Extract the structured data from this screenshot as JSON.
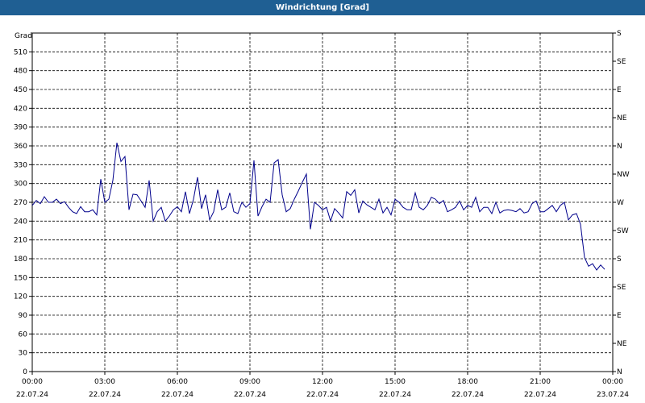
{
  "window": {
    "title": "Windrichtung [Grad]"
  },
  "chart_data": {
    "type": "line",
    "title": "Windrichtung [Grad]",
    "ylabel": "Grad",
    "ylim": [
      0,
      540
    ],
    "yticks": [
      0,
      30,
      60,
      90,
      120,
      150,
      180,
      210,
      240,
      270,
      300,
      330,
      360,
      390,
      420,
      450,
      480,
      510
    ],
    "right_axis_labels": [
      "N",
      "NE",
      "E",
      "SE",
      "S",
      "SW",
      "W",
      "NW",
      "N",
      "NE",
      "E",
      "SE",
      "S"
    ],
    "xlim": [
      "22.07.24 00:00",
      "23.07.24 00:00"
    ],
    "xticks": [
      {
        "time": "00:00",
        "date": "22.07.24"
      },
      {
        "time": "03:00",
        "date": "22.07.24"
      },
      {
        "time": "06:00",
        "date": "22.07.24"
      },
      {
        "time": "09:00",
        "date": "22.07.24"
      },
      {
        "time": "12:00",
        "date": "22.07.24"
      },
      {
        "time": "15:00",
        "date": "22.07.24"
      },
      {
        "time": "18:00",
        "date": "22.07.24"
      },
      {
        "time": "21:00",
        "date": "22.07.24"
      },
      {
        "time": "00:00",
        "date": "23.07.24"
      }
    ],
    "grid": true,
    "line_color": "#00008b",
    "series": [
      {
        "points": [
          [
            "22.07.24 00:00",
            265
          ],
          [
            "22.07.24 00:10",
            273
          ],
          [
            "22.07.24 00:20",
            268
          ],
          [
            "22.07.24 00:30",
            279
          ],
          [
            "22.07.24 00:40",
            270
          ],
          [
            "22.07.24 00:50",
            270
          ],
          [
            "22.07.24 01:00",
            275
          ],
          [
            "22.07.24 01:10",
            268
          ],
          [
            "22.07.24 01:20",
            271
          ],
          [
            "22.07.24 01:30",
            262
          ],
          [
            "22.07.24 01:40",
            255
          ],
          [
            "22.07.24 01:50",
            252
          ],
          [
            "22.07.24 02:00",
            263
          ],
          [
            "22.07.24 02:10",
            255
          ],
          [
            "22.07.24 02:20",
            255
          ],
          [
            "22.07.24 02:30",
            258
          ],
          [
            "22.07.24 02:40",
            250
          ],
          [
            "22.07.24 02:50",
            307
          ],
          [
            "22.07.24 03:00",
            270
          ],
          [
            "22.07.24 03:10",
            275
          ],
          [
            "22.07.24 03:20",
            305
          ],
          [
            "22.07.24 03:30",
            365
          ],
          [
            "22.07.24 03:40",
            335
          ],
          [
            "22.07.24 03:50",
            343
          ],
          [
            "22.07.24 04:00",
            258
          ],
          [
            "22.07.24 04:10",
            283
          ],
          [
            "22.07.24 04:20",
            282
          ],
          [
            "22.07.24 04:30",
            272
          ],
          [
            "22.07.24 04:40",
            262
          ],
          [
            "22.07.24 04:50",
            305
          ],
          [
            "22.07.24 05:00",
            240
          ],
          [
            "22.07.24 05:10",
            255
          ],
          [
            "22.07.24 05:20",
            262
          ],
          [
            "22.07.24 05:30",
            240
          ],
          [
            "22.07.24 05:40",
            248
          ],
          [
            "22.07.24 05:50",
            258
          ],
          [
            "22.07.24 06:00",
            263
          ],
          [
            "22.07.24 06:10",
            255
          ],
          [
            "22.07.24 06:20",
            287
          ],
          [
            "22.07.24 06:30",
            252
          ],
          [
            "22.07.24 06:40",
            275
          ],
          [
            "22.07.24 06:50",
            310
          ],
          [
            "22.07.24 07:00",
            260
          ],
          [
            "22.07.24 07:10",
            282
          ],
          [
            "22.07.24 07:20",
            242
          ],
          [
            "22.07.24 07:30",
            255
          ],
          [
            "22.07.24 07:40",
            290
          ],
          [
            "22.07.24 07:50",
            258
          ],
          [
            "22.07.24 08:00",
            262
          ],
          [
            "22.07.24 08:10",
            285
          ],
          [
            "22.07.24 08:20",
            255
          ],
          [
            "22.07.24 08:30",
            252
          ],
          [
            "22.07.24 08:40",
            270
          ],
          [
            "22.07.24 08:50",
            262
          ],
          [
            "22.07.24 09:00",
            268
          ],
          [
            "22.07.24 09:10",
            337
          ],
          [
            "22.07.24 09:20",
            248
          ],
          [
            "22.07.24 09:30",
            263
          ],
          [
            "22.07.24 09:40",
            275
          ],
          [
            "22.07.24 09:50",
            270
          ],
          [
            "22.07.24 10:00",
            333
          ],
          [
            "22.07.24 10:10",
            338
          ],
          [
            "22.07.24 10:20",
            282
          ],
          [
            "22.07.24 10:30",
            255
          ],
          [
            "22.07.24 10:40",
            260
          ],
          [
            "22.07.24 10:50",
            275
          ],
          [
            "22.07.24 11:00",
            288
          ],
          [
            "22.07.24 11:10",
            302
          ],
          [
            "22.07.24 11:20",
            315
          ],
          [
            "22.07.24 11:30",
            227
          ],
          [
            "22.07.24 11:40",
            270
          ],
          [
            "22.07.24 11:50",
            265
          ],
          [
            "22.07.24 12:00",
            258
          ],
          [
            "22.07.24 12:10",
            262
          ],
          [
            "22.07.24 12:20",
            240
          ],
          [
            "22.07.24 12:30",
            260
          ],
          [
            "22.07.24 12:40",
            253
          ],
          [
            "22.07.24 12:50",
            245
          ],
          [
            "22.07.24 13:00",
            287
          ],
          [
            "22.07.24 13:10",
            281
          ],
          [
            "22.07.24 13:20",
            290
          ],
          [
            "22.07.24 13:30",
            253
          ],
          [
            "22.07.24 13:40",
            272
          ],
          [
            "22.07.24 13:50",
            266
          ],
          [
            "22.07.24 14:00",
            262
          ],
          [
            "22.07.24 14:10",
            258
          ],
          [
            "22.07.24 14:20",
            275
          ],
          [
            "22.07.24 14:30",
            253
          ],
          [
            "22.07.24 14:40",
            262
          ],
          [
            "22.07.24 14:50",
            250
          ],
          [
            "22.07.24 15:00",
            275
          ],
          [
            "22.07.24 15:10",
            270
          ],
          [
            "22.07.24 15:20",
            262
          ],
          [
            "22.07.24 15:30",
            258
          ],
          [
            "22.07.24 15:40",
            258
          ],
          [
            "22.07.24 15:50",
            285
          ],
          [
            "22.07.24 16:00",
            262
          ],
          [
            "22.07.24 16:10",
            258
          ],
          [
            "22.07.24 16:20",
            265
          ],
          [
            "22.07.24 16:30",
            278
          ],
          [
            "22.07.24 16:40",
            275
          ],
          [
            "22.07.24 16:50",
            268
          ],
          [
            "22.07.24 17:00",
            273
          ],
          [
            "22.07.24 17:10",
            255
          ],
          [
            "22.07.24 17:20",
            258
          ],
          [
            "22.07.24 17:30",
            262
          ],
          [
            "22.07.24 17:40",
            272
          ],
          [
            "22.07.24 17:50",
            258
          ],
          [
            "22.07.24 18:00",
            265
          ],
          [
            "22.07.24 18:10",
            262
          ],
          [
            "22.07.24 18:20",
            278
          ],
          [
            "22.07.24 18:30",
            255
          ],
          [
            "22.07.24 18:40",
            262
          ],
          [
            "22.07.24 18:50",
            262
          ],
          [
            "22.07.24 19:00",
            252
          ],
          [
            "22.07.24 19:10",
            270
          ],
          [
            "22.07.24 19:20",
            253
          ],
          [
            "22.07.24 19:30",
            257
          ],
          [
            "22.07.24 19:40",
            258
          ],
          [
            "22.07.24 19:50",
            257
          ],
          [
            "22.07.24 20:00",
            255
          ],
          [
            "22.07.24 20:10",
            260
          ],
          [
            "22.07.24 20:20",
            253
          ],
          [
            "22.07.24 20:30",
            255
          ],
          [
            "22.07.24 20:40",
            268
          ],
          [
            "22.07.24 20:50",
            272
          ],
          [
            "22.07.24 21:00",
            255
          ],
          [
            "22.07.24 21:10",
            255
          ],
          [
            "22.07.24 21:20",
            260
          ],
          [
            "22.07.24 21:30",
            265
          ],
          [
            "22.07.24 21:40",
            255
          ],
          [
            "22.07.24 21:50",
            265
          ],
          [
            "22.07.24 22:00",
            270
          ],
          [
            "22.07.24 22:10",
            242
          ],
          [
            "22.07.24 22:20",
            250
          ],
          [
            "22.07.24 22:30",
            252
          ],
          [
            "22.07.24 22:40",
            235
          ],
          [
            "22.07.24 22:50",
            182
          ],
          [
            "22.07.24 23:00",
            168
          ],
          [
            "22.07.24 23:10",
            172
          ],
          [
            "22.07.24 23:20",
            162
          ],
          [
            "22.07.24 23:30",
            170
          ],
          [
            "22.07.24 23:40",
            163
          ]
        ]
      }
    ]
  }
}
